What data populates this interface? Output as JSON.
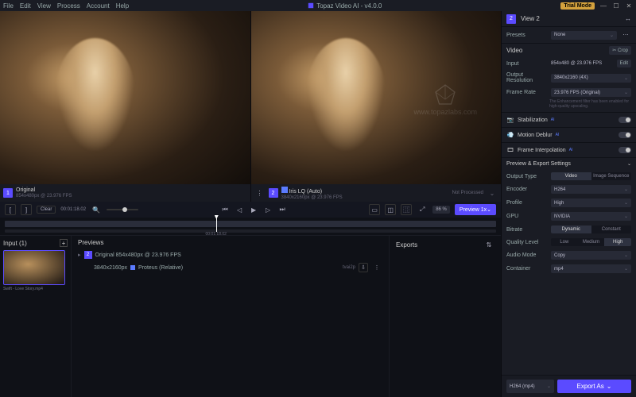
{
  "app": {
    "title": "Topaz Video AI - v4.0.0"
  },
  "menu": [
    "File",
    "Edit",
    "View",
    "Process",
    "Account",
    "Help"
  ],
  "titlebar": {
    "trial": "Trial Mode"
  },
  "viewer": {
    "left": {
      "badge": "1",
      "title": "Original",
      "meta": "854x480px @ 23.976 FPS"
    },
    "right": {
      "badge": "2",
      "title": "Iris LQ (Auto)",
      "meta": "3840x2160px @ 23.976 FPS",
      "status": "Not Processed"
    },
    "watermark": "www.topazlabs.com"
  },
  "transport": {
    "clear": "Clear",
    "time": "00:01:18.02",
    "preview_btn": "Preview 1x",
    "pct": "86 %",
    "tl_time": "00:01:18.02"
  },
  "inputs": {
    "header": "Input (1)",
    "thumb_label": "Swift - Love Story.mp4"
  },
  "previews": {
    "header": "Previews",
    "row1_badge": "2",
    "row1_text": "Original   854x480px @ 23.976 FPS",
    "row2_res": "3840x2160px",
    "row2_model": "Proteus (Relative)",
    "row2_fmt": "tvai2p"
  },
  "exports": {
    "header": "Exports"
  },
  "panel": {
    "view": {
      "badge": "2",
      "title": "View 2"
    },
    "presets": {
      "label": "Presets",
      "value": "None"
    },
    "video": {
      "label": "Video",
      "crop": "Crop",
      "input_lbl": "Input",
      "input_val": "854x480 @ 23.976 FPS",
      "edit": "Edit",
      "outres_lbl": "Output Resolution",
      "outres_val": "3840x2160 (4X)",
      "fps_lbl": "Frame Rate",
      "fps_val": "23.976 FPS (Original)",
      "note": "The Enhancement filter has been enabled for high-quality upscaling."
    },
    "stab": "Stabilization",
    "deblur": "Motion Deblur",
    "interp": "Frame Interpolation",
    "export_hdr": "Preview & Export Settings",
    "out_type_lbl": "Output Type",
    "out_type_a": "Video",
    "out_type_b": "Image Sequence",
    "encoder_lbl": "Encoder",
    "encoder_val": "H264",
    "profile_lbl": "Profile",
    "profile_val": "High",
    "gpu_lbl": "GPU",
    "gpu_val": "NVIDIA",
    "bitrate_lbl": "Bitrate",
    "bitrate_a": "Dynamic",
    "bitrate_b": "Constant",
    "quality_lbl": "Quality Level",
    "quality_a": "Low",
    "quality_b": "Medium",
    "quality_c": "High",
    "audio_lbl": "Audio Mode",
    "audio_val": "Copy",
    "container_lbl": "Container",
    "container_val": "mp4",
    "footer_fmt": "H264 (mp4)",
    "export_btn": "Export As"
  }
}
